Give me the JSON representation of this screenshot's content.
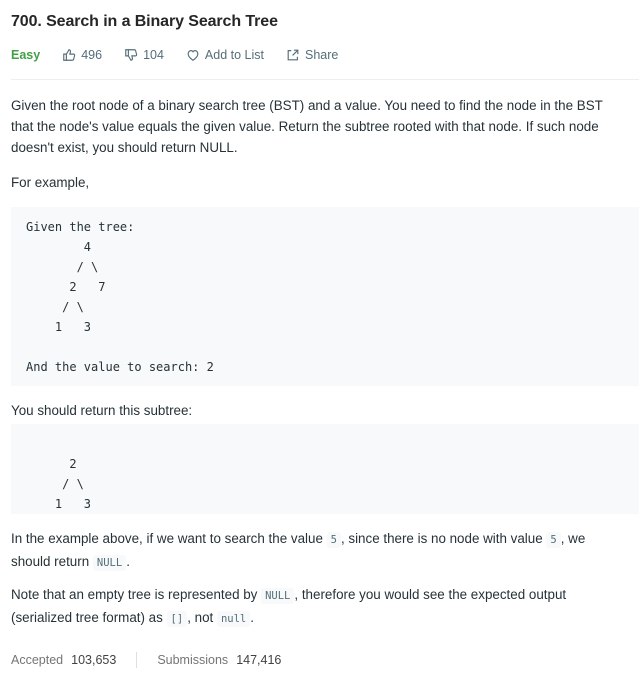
{
  "problem": {
    "title": "700. Search in a Binary Search Tree",
    "difficulty": "Easy",
    "likes": "496",
    "dislikes": "104",
    "add_to_list": "Add to List",
    "share": "Share"
  },
  "description": {
    "intro": "Given the root node of a binary search tree (BST) and a value. You need to find the node in the BST that the node's value equals the given value. Return the subtree rooted with that node. If such node doesn't exist, you should return NULL.",
    "for_example": "For example,",
    "example_block": "Given the tree:\n        4\n       / \\\n      2   7\n     / \\\n    1   3\n\nAnd the value to search: 2",
    "return_text": "You should return this subtree:",
    "return_block": "\n      2\n     / \\\n    1   3",
    "note1": {
      "part1": "In the example above, if we want to search the value ",
      "code1": "5",
      "part2": ", since there is no node with value ",
      "code2": "5",
      "part3": ", we should return ",
      "code3": "NULL",
      "part4": "."
    },
    "note2": {
      "part1": "Note that an empty tree is represented by ",
      "code1": "NULL",
      "part2": ", therefore you would see the expected output (serialized tree format) as ",
      "code2": "[]",
      "part3": ", not ",
      "code3": "null",
      "part4": "."
    }
  },
  "stats": {
    "accepted_label": "Accepted",
    "accepted_value": "103,653",
    "submissions_label": "Submissions",
    "submissions_value": "147,416"
  },
  "icons": {
    "like": "thumbs-up-icon",
    "dislike": "thumbs-down-icon",
    "add_to_list": "heart-icon",
    "share": "share-icon"
  },
  "colors": {
    "easy": "#43a047",
    "code_bg": "#f7f9fa"
  }
}
